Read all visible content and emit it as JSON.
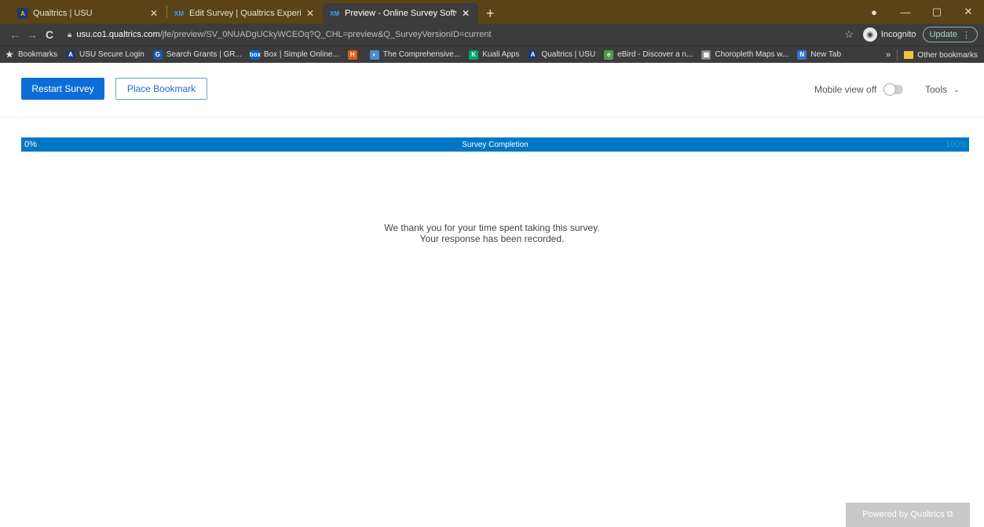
{
  "browser": {
    "tabs": [
      {
        "title": "Qualtrics | USU",
        "favicon": "A"
      },
      {
        "title": "Edit Survey | Qualtrics Experience",
        "favicon": "XM"
      },
      {
        "title": "Preview - Online Survey Software",
        "favicon": "XM"
      }
    ],
    "new_tab": "+",
    "address": {
      "host": "usu.co1.qualtrics.com",
      "path": "/jfe/preview/SV_0NUADgUCkyWCEOq?Q_CHL=preview&Q_SurveyVersionID=current"
    },
    "incognito_label": "Incognito",
    "update_label": "Update",
    "bookmarks": [
      {
        "label": "Bookmarks",
        "icon": "★",
        "color": "#e0e0e0"
      },
      {
        "label": "USU Secure Login",
        "icon": "A",
        "color": "#1f3a6b"
      },
      {
        "label": "Search Grants | GR...",
        "icon": "G",
        "color": "#1a5aa8"
      },
      {
        "label": "Box | Simple Online...",
        "icon": "box",
        "color": "#0061d5"
      },
      {
        "label": "",
        "icon": "H",
        "color": "#e05a1a"
      },
      {
        "label": "The Comprehensive...",
        "icon": "◐",
        "color": "#4a90d0"
      },
      {
        "label": "Kuali Apps",
        "icon": "K",
        "color": "#00a36c"
      },
      {
        "label": "Qualtrics | USU",
        "icon": "A",
        "color": "#1f3a6b"
      },
      {
        "label": "eBird - Discover a n...",
        "icon": "e",
        "color": "#4aa04a"
      },
      {
        "label": "Choropleth Maps w...",
        "icon": "▦",
        "color": "#888888"
      },
      {
        "label": "New Tab",
        "icon": "N",
        "color": "#3a70d0"
      }
    ],
    "bookmarks_overflow": "»",
    "other_bookmarks": "Other bookmarks"
  },
  "survey": {
    "restart_label": "Restart Survey",
    "bookmark_label": "Place Bookmark",
    "mobile_view_label": "Mobile view off",
    "tools_label": "Tools",
    "progress": {
      "start_label": "0%",
      "center_label": "Survey Completion",
      "end_label": "100%",
      "value": 1.0
    },
    "thanks_line1": "We thank you for your time spent taking this survey.",
    "thanks_line2": "Your response has been recorded.",
    "powered_label": "Powered by Qualtrics ⧉"
  }
}
